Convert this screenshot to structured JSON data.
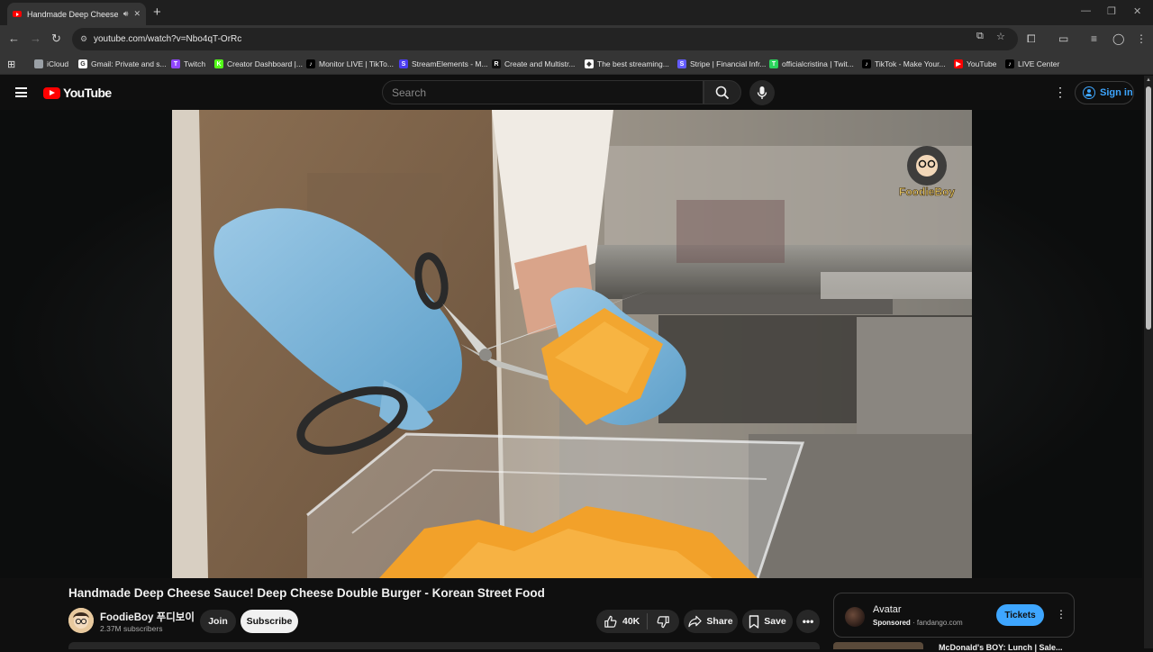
{
  "browser": {
    "tab": {
      "title": "Handmade Deep Cheese Sa"
    },
    "url": "youtube.com/watch?v=Nbo4qT-OrRc",
    "bookmarks": [
      {
        "label": "iCloud",
        "color": "#9aa0a6",
        "glyph": ""
      },
      {
        "label": "Gmail: Private and s...",
        "color": "#ffffff",
        "glyph": "G"
      },
      {
        "label": "Twitch",
        "color": "#9146ff",
        "glyph": "T"
      },
      {
        "label": "Creator Dashboard |...",
        "color": "#53fc18",
        "glyph": "K"
      },
      {
        "label": "Monitor LIVE | TikTo...",
        "color": "#000000",
        "glyph": "♪"
      },
      {
        "label": "StreamElements - M...",
        "color": "#4b3cf0",
        "glyph": "S"
      },
      {
        "label": "Create and Multistr...",
        "color": "#111111",
        "glyph": "R"
      },
      {
        "label": "The best streaming...",
        "color": "#ffffff",
        "glyph": "◆"
      },
      {
        "label": "Stripe | Financial Infr...",
        "color": "#635bff",
        "glyph": "S"
      },
      {
        "label": "officialcristina | Twit...",
        "color": "#2bd35c",
        "glyph": "T"
      },
      {
        "label": "TikTok - Make Your...",
        "color": "#000000",
        "glyph": "♪"
      },
      {
        "label": "YouTube",
        "color": "#ff0000",
        "glyph": "▶"
      },
      {
        "label": "LIVE Center",
        "color": "#000000",
        "glyph": "♪"
      }
    ]
  },
  "youtube": {
    "logo_text": "YouTube",
    "search_placeholder": "Search",
    "sign_in": "Sign in",
    "watermark": "FoodieBoy"
  },
  "video": {
    "title": "Handmade Deep Cheese Sauce! Deep Cheese Double Burger - Korean Street Food",
    "channel": "FoodieBoy 푸디보이",
    "subscribers": "2.37M subscribers",
    "join": "Join",
    "subscribe": "Subscribe",
    "likes": "40K",
    "share": "Share",
    "save": "Save"
  },
  "ad": {
    "title": "Avatar",
    "sponsored": "Sponsored",
    "domain": "· fandango.com",
    "cta": "Tickets"
  },
  "next_video": {
    "title": "McDonald's BOY: Lunch | Sale..."
  },
  "colors": {
    "accent": "#3ea6ff",
    "brand": "#ff0000",
    "background": "#0f0f0f"
  }
}
